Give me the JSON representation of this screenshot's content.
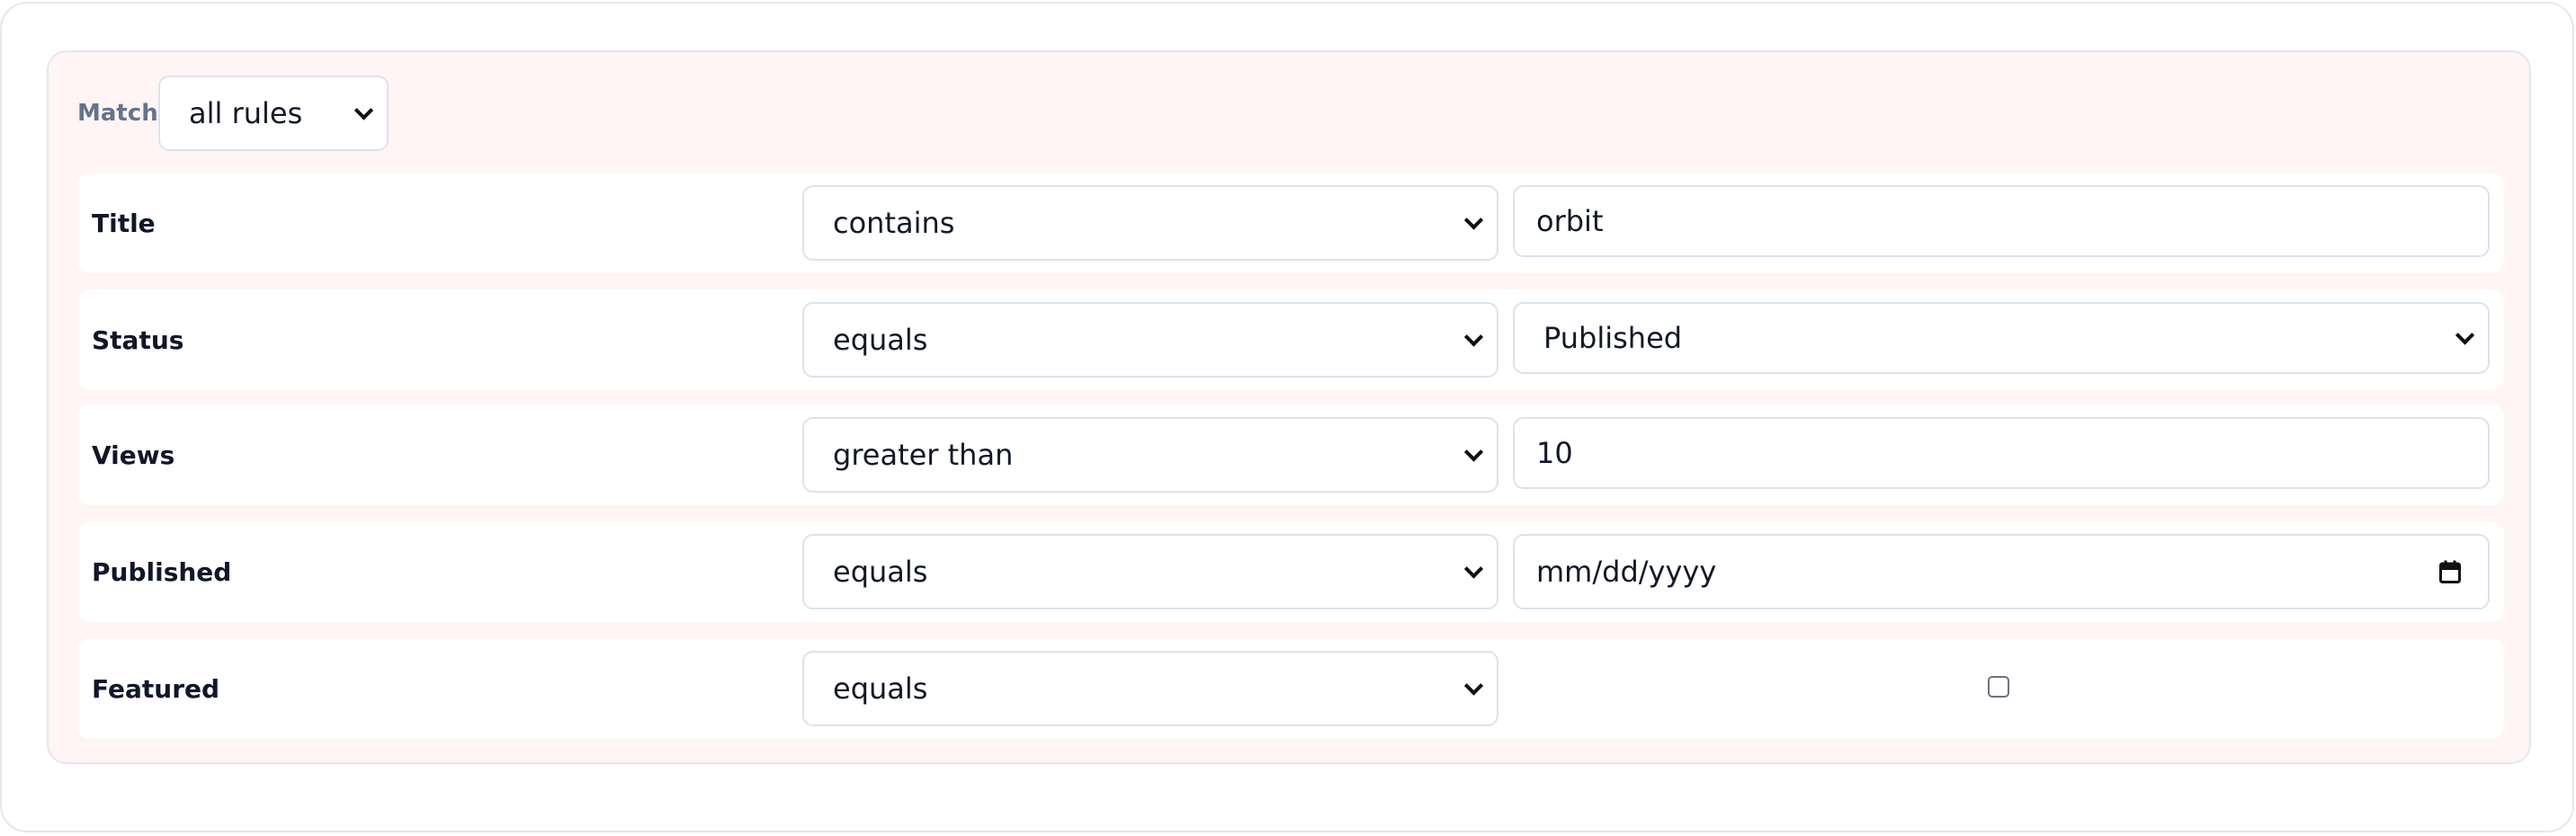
{
  "match": {
    "label": "Match",
    "value": "all rules"
  },
  "rules": [
    {
      "field": "Title",
      "operator": "contains",
      "value": "orbit",
      "kind": "text"
    },
    {
      "field": "Status",
      "operator": "equals",
      "value": "Published",
      "kind": "select"
    },
    {
      "field": "Views",
      "operator": "greater than",
      "value": "10",
      "kind": "number"
    },
    {
      "field": "Published",
      "operator": "equals",
      "placeholder": "mm/dd/yyyy",
      "kind": "date"
    },
    {
      "field": "Featured",
      "operator": "equals",
      "checked": false,
      "kind": "checkbox"
    }
  ],
  "colors": {
    "group_bg": "#fef5f4",
    "border": "#dbe3ec",
    "label_muted": "#64748b"
  }
}
